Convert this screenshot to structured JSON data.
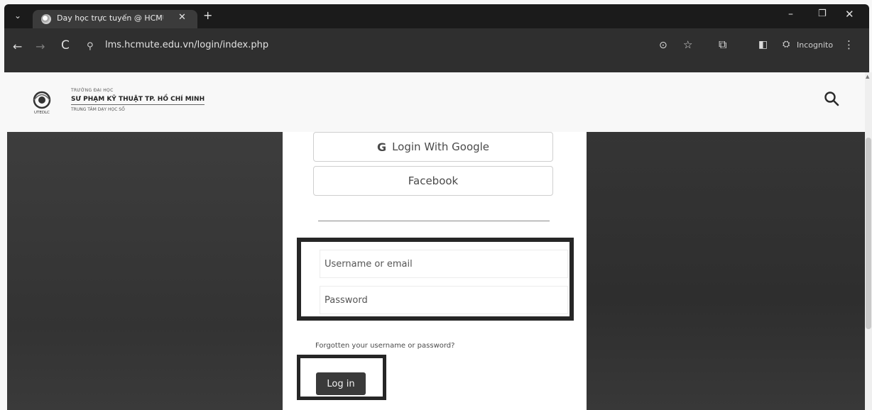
{
  "browser": {
    "tab_title": "Day học trực tuyến @ HCMUTE",
    "tab_close": "✕",
    "new_tab": "+",
    "tab_list": "⌄",
    "address": "lms.hcmute.edu.vn/login/index.php",
    "incognito_label": "Incognito",
    "icons": {
      "back": "←",
      "forward": "→",
      "reload": "C",
      "site_info": "⚲",
      "key": "⊙",
      "star": "☆",
      "extensions": "⧉",
      "side_panel": "◧",
      "incognito": "⛭",
      "menu": "⋮",
      "minimize": "–",
      "maximize": "❐",
      "close": "✕"
    }
  },
  "site": {
    "logo_line1": "TRƯỜNG ĐẠI HỌC",
    "logo_line2": "SƯ PHẠM KỸ THUẬT TP. HỒ CHÍ MINH",
    "logo_line3": "TRUNG TÂM DẠY HỌC SỐ",
    "logo_caption": "UTEDLC"
  },
  "login": {
    "google_label": "Login With Google",
    "google_glyph": "G",
    "facebook_label": "Facebook",
    "username_placeholder": "Username or email",
    "password_placeholder": "Password",
    "forgot_label": "Forgotten your username or password?",
    "login_button": "Log in"
  },
  "colors": {
    "page_bg": "#f7f7f7",
    "chrome_dark": "#1b1b1b",
    "toolbar": "#2f2f2f",
    "panel_dark": "#393939",
    "highlight_border": "#262626",
    "login_button_bg": "#3a3a3a"
  }
}
